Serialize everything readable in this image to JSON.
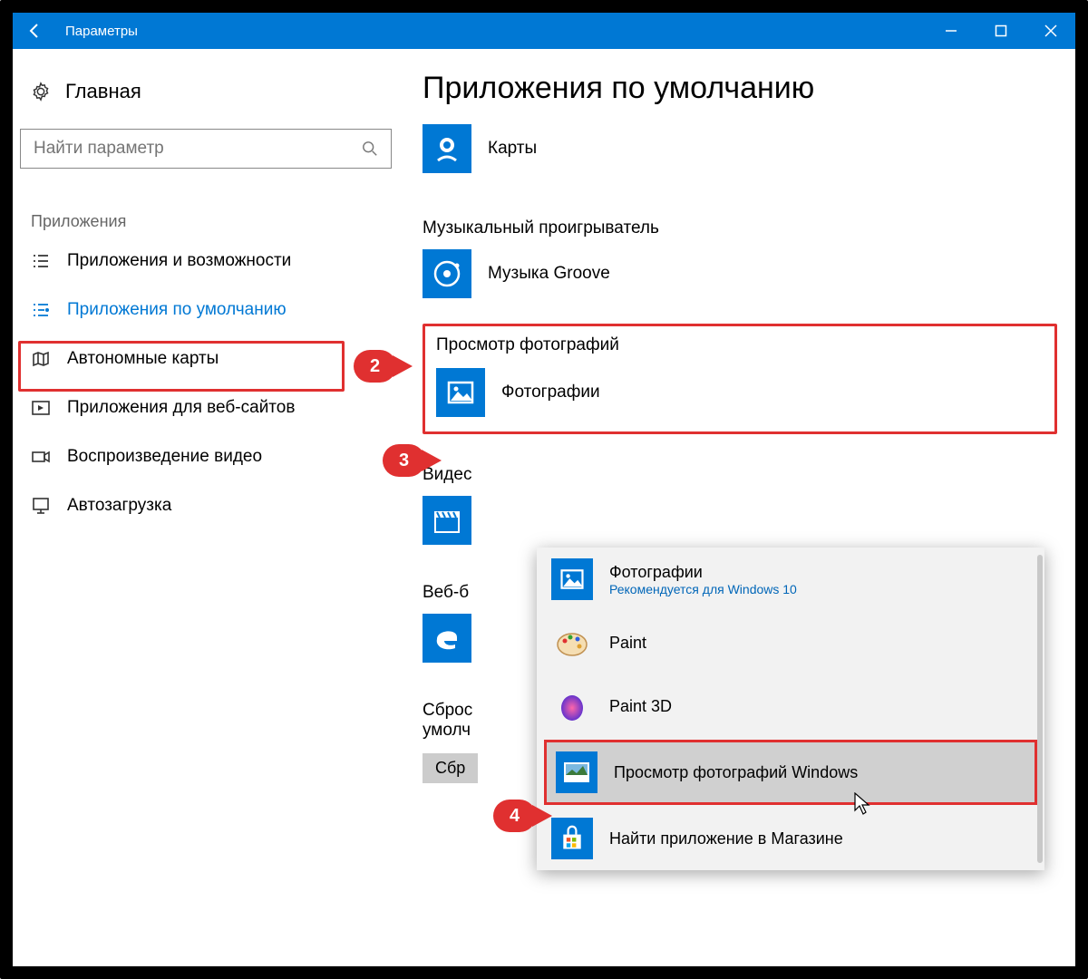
{
  "titlebar": {
    "title": "Параметры"
  },
  "sidebar": {
    "home_label": "Главная",
    "search_placeholder": "Найти параметр",
    "section_label": "Приложения",
    "items": [
      {
        "label": "Приложения и возможности"
      },
      {
        "label": "Приложения по умолчанию"
      },
      {
        "label": "Автономные карты"
      },
      {
        "label": "Приложения для веб-сайтов"
      },
      {
        "label": "Воспроизведение видео"
      },
      {
        "label": "Автозагрузка"
      }
    ]
  },
  "main": {
    "page_title": "Приложения по умолчанию",
    "maps": {
      "label": "Карты"
    },
    "music": {
      "group": "Музыкальный проигрыватель",
      "app": "Музыка Groove"
    },
    "photos": {
      "group": "Просмотр фотографий",
      "app": "Фотографии"
    },
    "video_cut": "Видес",
    "web_cut": "Веб-б",
    "reset_line1": "Сброс",
    "reset_line2": "умолч",
    "reset_btn": "Сбр"
  },
  "flyout": {
    "items": [
      {
        "name": "Фотографии",
        "sub": "Рекомендуется для Windows 10"
      },
      {
        "name": "Paint"
      },
      {
        "name": "Paint 3D"
      },
      {
        "name": "Просмотр фотографий Windows"
      },
      {
        "name": "Найти приложение в Магазине"
      }
    ]
  },
  "annotations": {
    "n2": "2",
    "n3": "3",
    "n4": "4"
  }
}
